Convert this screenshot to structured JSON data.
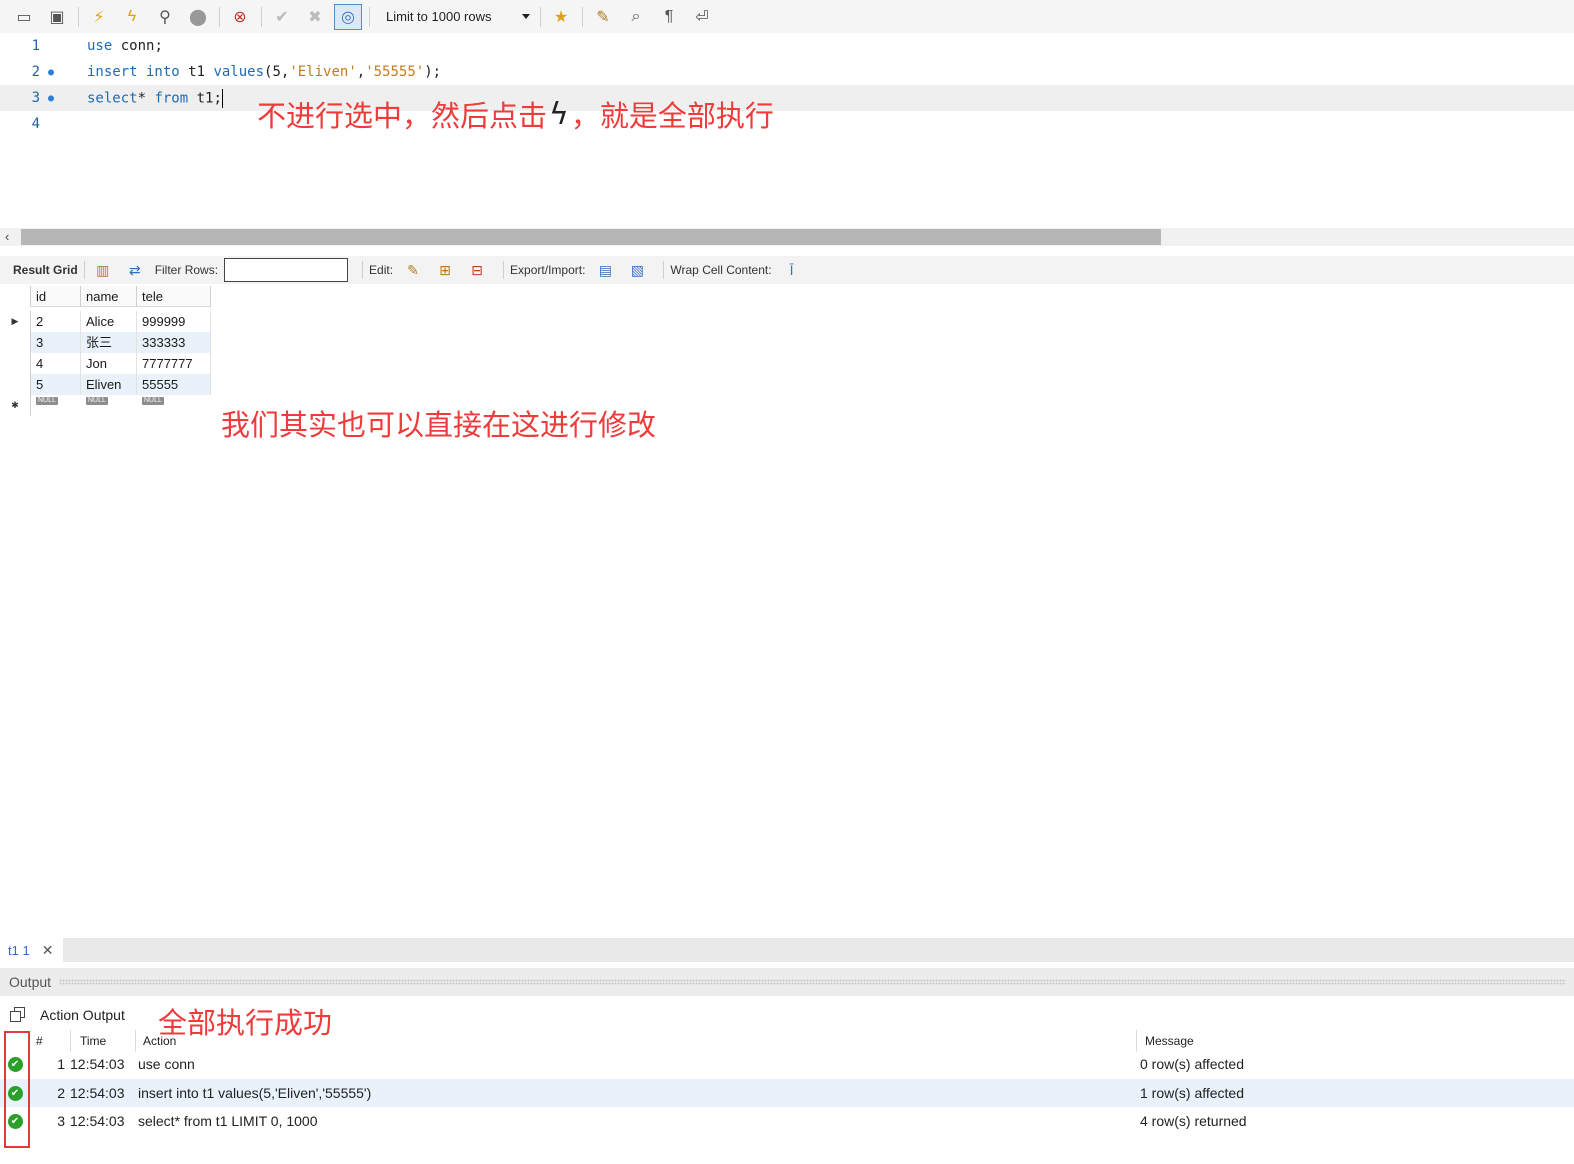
{
  "toolbar": {
    "limit_label": "Limit to 1000 rows",
    "icons": [
      "open-folder-icon",
      "save-icon",
      "execute-icon",
      "execute-current-icon",
      "explain-icon",
      "stop-icon",
      "toggle-error-icon",
      "commit-icon",
      "rollback-icon",
      "autocommit-icon",
      "add-snippet-icon",
      "beautify-icon",
      "find-icon",
      "invisible-chars-icon",
      "wrap-icon"
    ]
  },
  "editor": {
    "lines": [
      {
        "num": "1",
        "tokens": [
          {
            "t": "use",
            "k": "kw"
          },
          {
            "t": " conn;",
            "k": ""
          }
        ]
      },
      {
        "num": "2",
        "tokens": [
          {
            "t": "insert into",
            "k": "kw"
          },
          {
            "t": " t1 ",
            "k": ""
          },
          {
            "t": "values",
            "k": "kw"
          },
          {
            "t": "(5,",
            "k": ""
          },
          {
            "t": "'Eliven'",
            "k": "str"
          },
          {
            "t": ",",
            "k": ""
          },
          {
            "t": "'55555'",
            "k": "str"
          },
          {
            "t": ");",
            "k": ""
          }
        ]
      },
      {
        "num": "3",
        "tokens": [
          {
            "t": "select",
            "k": "kw"
          },
          {
            "t": "* ",
            "k": ""
          },
          {
            "t": "from",
            "k": "kw"
          },
          {
            "t": " t1;",
            "k": ""
          }
        ]
      },
      {
        "num": "4",
        "tokens": []
      }
    ]
  },
  "annotations": {
    "editor_note_a": "不进行选中，然后点击",
    "editor_note_b": "，就是全部执行",
    "grid_note": "我们其实也可以直接在这进行修改",
    "output_note": "全部执行成功"
  },
  "result_bar": {
    "result_grid": "Result Grid",
    "filter_rows": "Filter Rows:",
    "edit": "Edit:",
    "export_import": "Export/Import:",
    "wrap": "Wrap Cell Content:"
  },
  "grid": {
    "columns": [
      "id",
      "name",
      "tele"
    ],
    "rows": [
      [
        "2",
        "Alice",
        "999999"
      ],
      [
        "3",
        "张三",
        "333333"
      ],
      [
        "4",
        "Jon",
        "7777777"
      ],
      [
        "5",
        "Eliven",
        "55555"
      ]
    ],
    "null_label": "NULL"
  },
  "tab": {
    "label": "t1 1",
    "close": "✕"
  },
  "output": {
    "title": "Output",
    "mode": "Action Output",
    "columns": {
      "num": "#",
      "time": "Time",
      "action": "Action",
      "message": "Message"
    },
    "rows": [
      {
        "num": "1",
        "time": "12:54:03",
        "action": "use conn",
        "message": "0 row(s) affected"
      },
      {
        "num": "2",
        "time": "12:54:03",
        "action": "insert into t1 values(5,'Eliven','55555')",
        "message": "1 row(s) affected"
      },
      {
        "num": "3",
        "time": "12:54:03",
        "action": "select* from t1 LIMIT 0, 1000",
        "message": "4 row(s) returned"
      }
    ]
  }
}
